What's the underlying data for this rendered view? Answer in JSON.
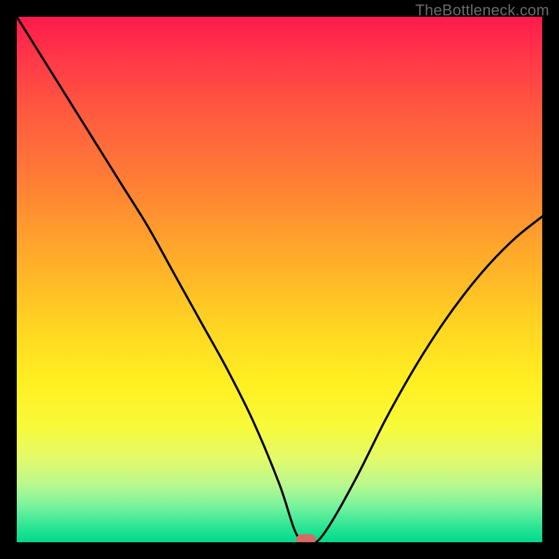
{
  "watermark": "TheBottleneck.com",
  "chart_data": {
    "type": "line",
    "title": "",
    "xlabel": "",
    "ylabel": "",
    "xlim": [
      0,
      100
    ],
    "ylim": [
      0,
      100
    ],
    "grid": false,
    "series": [
      {
        "name": "bottleneck-curve",
        "x": [
          0,
          5,
          10,
          15,
          20,
          25,
          30,
          35,
          40,
          45,
          50,
          53,
          55,
          57,
          60,
          65,
          70,
          75,
          80,
          85,
          90,
          95,
          100
        ],
        "y": [
          100,
          92,
          84,
          76,
          68,
          60,
          51,
          42,
          33,
          23,
          11,
          2,
          0,
          0,
          4,
          13,
          23,
          32,
          40,
          47,
          53,
          58,
          62
        ]
      }
    ],
    "marker": {
      "x": 55,
      "y": 0.5,
      "color": "#d86a63"
    },
    "background_gradient": {
      "direction": "vertical",
      "stops": [
        {
          "pos": 0.0,
          "color": "#ff1a4b"
        },
        {
          "pos": 0.5,
          "color": "#ffd822"
        },
        {
          "pos": 0.8,
          "color": "#f8fa3a"
        },
        {
          "pos": 1.0,
          "color": "#00d98b"
        }
      ]
    }
  }
}
